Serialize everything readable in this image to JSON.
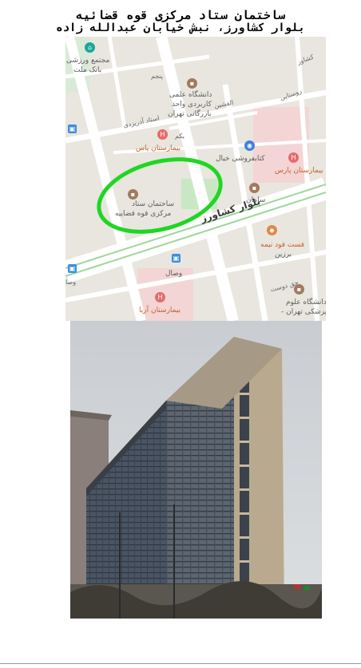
{
  "header": {
    "title": "ساختمان ستاد مرکزی قوه قضائیه",
    "subtitle": "بلوار کشاورز، نبش خیابان عبدالله زاده"
  },
  "map": {
    "labels": {
      "building_line1": "ساختمان ستاد",
      "building_line2": "مرکزی قوه قضاییه",
      "boulevard": "بلوار کشاورز",
      "university_line1": "دانشگاه علمی",
      "university_line2": "کاربردی واحد",
      "university_line3": "بازرگانی تهران",
      "hospital_pas": "بیمارستان پاس",
      "hospital_pars": "بیمارستان پارس",
      "hospital_arya": "بیمارستان آریا",
      "bookstore": "کتابفروشی خیال",
      "samand": "سامان",
      "fastfood_line1": "فست فود نیمه",
      "fastfood_line2": "برزین",
      "vesal": "وصال",
      "medical_univ_line1": "دانشگاه علوم",
      "medical_univ_line2": "پزشکی تهران -",
      "sports_line1": "مجتمع ورزشی",
      "sports_line2": "بانک ملت",
      "street_panjom": "پنجم",
      "street_ostad": "استاد آذریزدی",
      "street_yekom": "یکم",
      "street_alshin": "القشین",
      "street_rostaki": "روستایی",
      "street_doost": "حق دوست",
      "street_keshavarz": "کشاور",
      "street_vesal_short": "وصا"
    },
    "colors": {
      "highlight": "#1fd623",
      "road": "#ffffff",
      "block": "#e8e6df",
      "hospital_area": "#f1d7d7",
      "park": "#c9e7c4"
    }
  },
  "photo": {
    "subject": "office-tower"
  }
}
